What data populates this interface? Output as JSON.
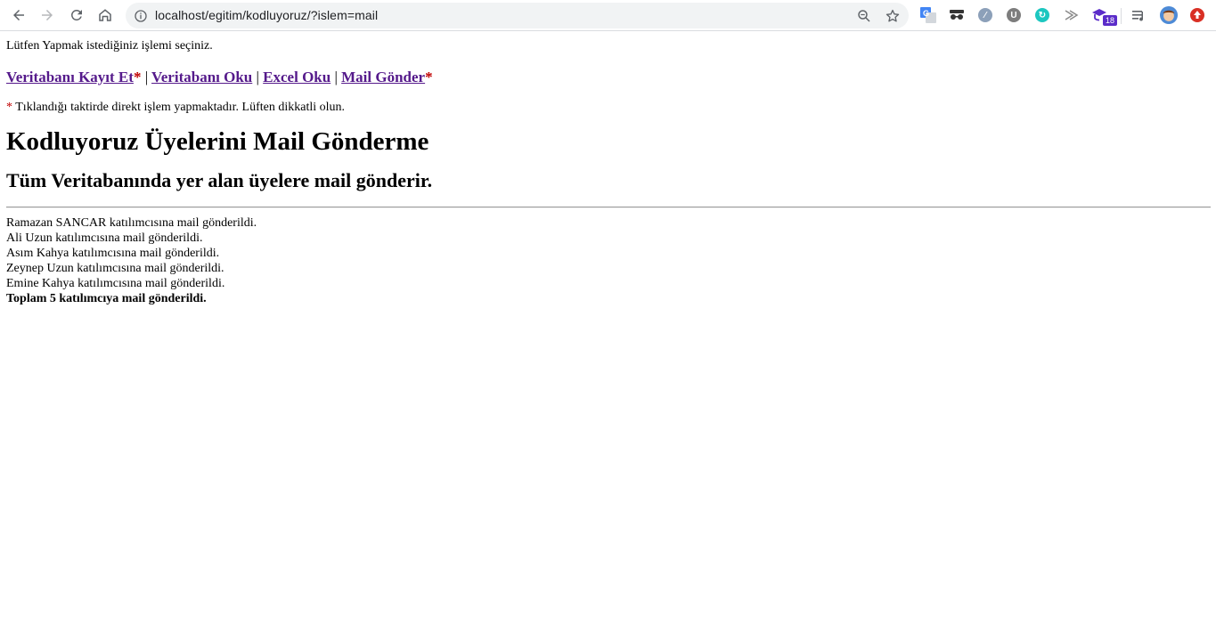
{
  "browser": {
    "url": "localhost/egitim/kodluyoruz/?islem=mail",
    "extension_badge": "18"
  },
  "page": {
    "intro": "Lütfen Yapmak istediğiniz işlemi seçiniz.",
    "links": [
      {
        "label": "Veritabanı Kayıt Et",
        "marker": "*"
      },
      {
        "label": "Veritabanı Oku",
        "marker": ""
      },
      {
        "label": "Excel Oku",
        "marker": ""
      },
      {
        "label": "Mail Gönder",
        "marker": "*"
      }
    ],
    "separator": "|",
    "note_marker": "*",
    "note": "Tıklandığı taktirde direkt işlem yapmaktadır. Lüften dikkatli olun.",
    "heading": "Kodluyoruz Üyelerini Mail Gönderme",
    "subheading": "Tüm Veritabanında yer alan üyelere mail gönderir.",
    "results": [
      "Ramazan SANCAR katılımcısına mail gönderildi.",
      "Ali Uzun katılımcısına mail gönderildi.",
      "Asım Kahya katılımcısına mail gönderildi.",
      "Zeynep Uzun katılımcısına mail gönderildi.",
      "Emine Kahya katılımcısına mail gönderildi."
    ],
    "total": "Toplam 5 katılımcıya mail gönderildi."
  }
}
